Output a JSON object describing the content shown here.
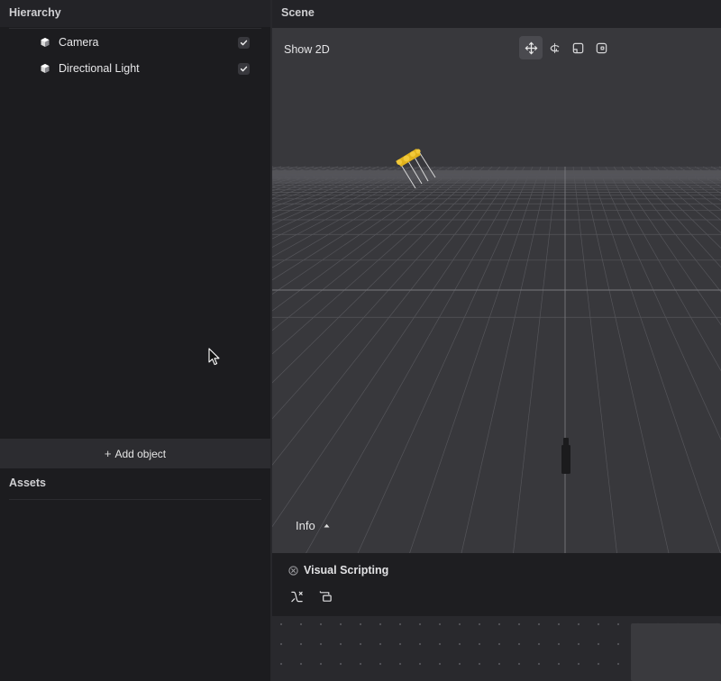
{
  "hierarchy": {
    "title": "Hierarchy",
    "items": [
      {
        "label": "Camera",
        "icon": "cube-icon",
        "enabled": true
      },
      {
        "label": "Directional Light",
        "icon": "cube-icon",
        "enabled": true
      }
    ],
    "add_label": "Add object"
  },
  "assets": {
    "title": "Assets"
  },
  "scene": {
    "title": "Scene",
    "show2d_label": "Show 2D",
    "tools": [
      "move-tool-icon",
      "rotate-tool-icon",
      "scale-tool-icon",
      "rect-tool-icon"
    ],
    "active_tool": "move-tool-icon",
    "info_label": "Info"
  },
  "visual_scripting": {
    "title": "Visual Scripting",
    "tools": [
      "curve-connector-icon",
      "group-node-icon"
    ]
  },
  "colors": {
    "background": "#1c1c1f",
    "viewport": "#38383c",
    "accent_gizmo": "#e0b21c"
  }
}
